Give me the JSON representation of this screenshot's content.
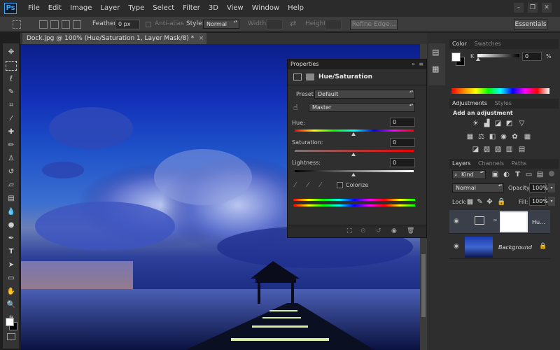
{
  "app": {
    "logo": "Ps"
  },
  "menu": [
    "File",
    "Edit",
    "Image",
    "Layer",
    "Type",
    "Select",
    "Filter",
    "3D",
    "View",
    "Window",
    "Help"
  ],
  "window_controls": {
    "minimize": "–",
    "restore": "❐",
    "close": "✕"
  },
  "options_bar": {
    "feather_label": "Feather:",
    "feather_value": "0 px",
    "antialias_label": "Anti-alias",
    "style_label": "Style:",
    "style_value": "Normal",
    "width_label": "Width:",
    "height_label": "Height:",
    "refine_edge": "Refine Edge...",
    "workspace": "Essentials"
  },
  "document_tab": {
    "title": "Dock.jpg @ 100% (Hue/Saturation 1, Layer Mask/8) *",
    "close": "×"
  },
  "properties": {
    "header": "Properties",
    "title": "Hue/Saturation",
    "preset_label": "Preset:",
    "preset_value": "Default",
    "range_value": "Master",
    "hue_label": "Hue:",
    "hue_value": "0",
    "saturation_label": "Saturation:",
    "saturation_value": "0",
    "lightness_label": "Lightness:",
    "lightness_value": "0",
    "colorize_label": "Colorize"
  },
  "color_panel": {
    "tabs": [
      "Color",
      "Swatches"
    ],
    "channel_label": "K",
    "value": "0",
    "unit": "%"
  },
  "adjustments_panel": {
    "tabs": [
      "Adjustments",
      "Styles"
    ],
    "heading": "Add an adjustment"
  },
  "layers_panel": {
    "tabs": [
      "Layers",
      "Channels",
      "Paths"
    ],
    "filter_value": "Kind",
    "blend_mode": "Normal",
    "opacity_label": "Opacity:",
    "opacity_value": "100%",
    "lock_label": "Lock:",
    "fill_label": "Fill:",
    "fill_value": "100%",
    "layers": [
      {
        "name": "Hu..."
      },
      {
        "name": "Background"
      }
    ]
  },
  "colors": {
    "accent": "#31a8ff",
    "panel_bg": "#2e2e2e",
    "menubar_bg": "#2b2b2b"
  }
}
